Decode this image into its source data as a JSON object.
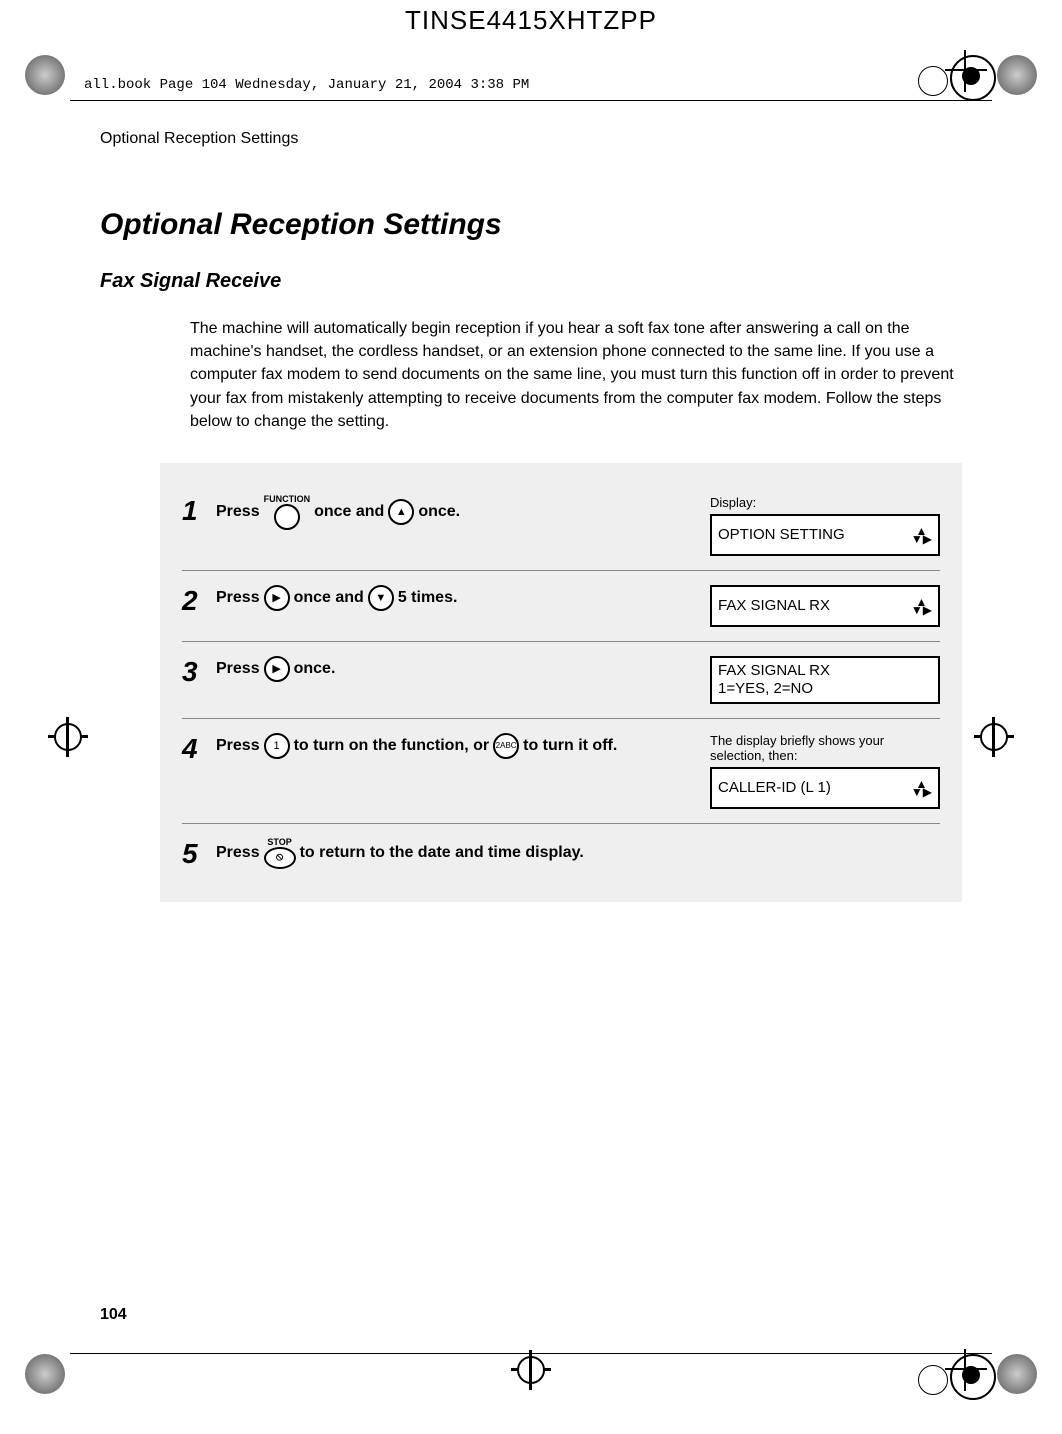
{
  "header_code": "TINSE4415XHTZPP",
  "book_note": "all.book  Page 104  Wednesday, January 21, 2004  3:38 PM",
  "breadcrumb": "Optional Reception Settings",
  "heading1": "Optional Reception Settings",
  "heading2": "Fax Signal Receive",
  "paragraph": "The machine will automatically begin reception if you hear a soft fax tone after answering a call on the machine's handset, the cordless handset, or an extension phone connected to the same line. If you use a computer fax modem to send documents on the same line, you must turn this function off in order to prevent your fax from mistakenly attempting to receive documents from the computer fax modem. Follow the steps below to change the setting.",
  "labels": {
    "display": "Display:",
    "function": "FUNCTION",
    "stop": "STOP"
  },
  "steps": [
    {
      "num": "1",
      "parts": [
        "Press ",
        "{FUNCTION}",
        " once and ",
        "{UP}",
        " once."
      ],
      "right_label": "Display:",
      "lcd": "OPTION SETTING",
      "arrows": true
    },
    {
      "num": "2",
      "parts": [
        "Press ",
        "{RIGHT}",
        " once and ",
        "{DOWN}",
        " 5 times."
      ],
      "lcd": "FAX SIGNAL RX",
      "arrows": true
    },
    {
      "num": "3",
      "parts": [
        "Press ",
        "{RIGHT}",
        " once."
      ],
      "lcd": "FAX SIGNAL RX\n1=YES, 2=NO",
      "arrows": false
    },
    {
      "num": "4",
      "parts": [
        "Press ",
        "{KEY1}",
        " to turn on the function, or ",
        "{KEY2}",
        " to turn it off."
      ],
      "right_label": "The display briefly shows your selection, then:",
      "lcd": "CALLER-ID (L 1)",
      "arrows": true
    },
    {
      "num": "5",
      "parts": [
        "Press ",
        "{STOP}",
        " to return to the date and time display."
      ],
      "lcd": null
    }
  ],
  "keys": {
    "1": "1",
    "2abc": "2ABC"
  },
  "page_number": "104"
}
